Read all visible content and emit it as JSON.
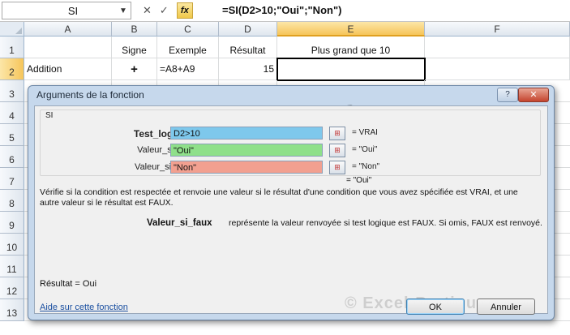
{
  "formula_bar": {
    "name_box": "SI",
    "cancel_glyph": "✕",
    "enter_glyph": "✓",
    "fx_label": "fx",
    "formula": "=SI(D2>10;\"Oui\";\"Non\")"
  },
  "columns": [
    "A",
    "B",
    "C",
    "D",
    "E",
    "F"
  ],
  "rows": [
    "1",
    "2",
    "3",
    "4",
    "5",
    "6",
    "7",
    "8",
    "9",
    "10",
    "11",
    "12",
    "13"
  ],
  "cells": {
    "B1": "Signe",
    "C1": "Exemple",
    "D1": "Résultat",
    "E1": "Plus grand que 10",
    "A2": "Addition",
    "B2": "+",
    "C2": "=A8+A9",
    "D2": "15"
  },
  "dialog": {
    "title": "Arguments de la fonction",
    "help_glyph": "?",
    "close_glyph": "✕",
    "function_name": "SI",
    "args": [
      {
        "label": "Test_logique",
        "value": "D2>10",
        "result": "=  VRAI",
        "color": "#7ec8ec"
      },
      {
        "label": "Valeur_si_vrai",
        "value": "\"Oui\"",
        "result": "=  \"Oui\"",
        "color": "#8fe08a"
      },
      {
        "label": "Valeur_si_faux",
        "value": "\"Non\"",
        "result": "=  \"Non\"",
        "color": "#f2a090"
      }
    ],
    "formula_result": "=  \"Oui\"",
    "description": "Vérifie si la condition est respectée et renvoie une valeur si le résultat d'une condition que vous avez spécifiée est VRAI, et une autre valeur si le résultat est FAUX.",
    "arg_name": "Valeur_si_faux",
    "arg_description": "représente la valeur renvoyée si test logique est FAUX. Si omis, FAUX est renvoyé.",
    "result_line": "Résultat =  Oui",
    "help_link": "Aide sur cette fonction",
    "ok_label": "OK",
    "cancel_label": "Annuler",
    "watermark": "© Excel-Pratique.com"
  }
}
